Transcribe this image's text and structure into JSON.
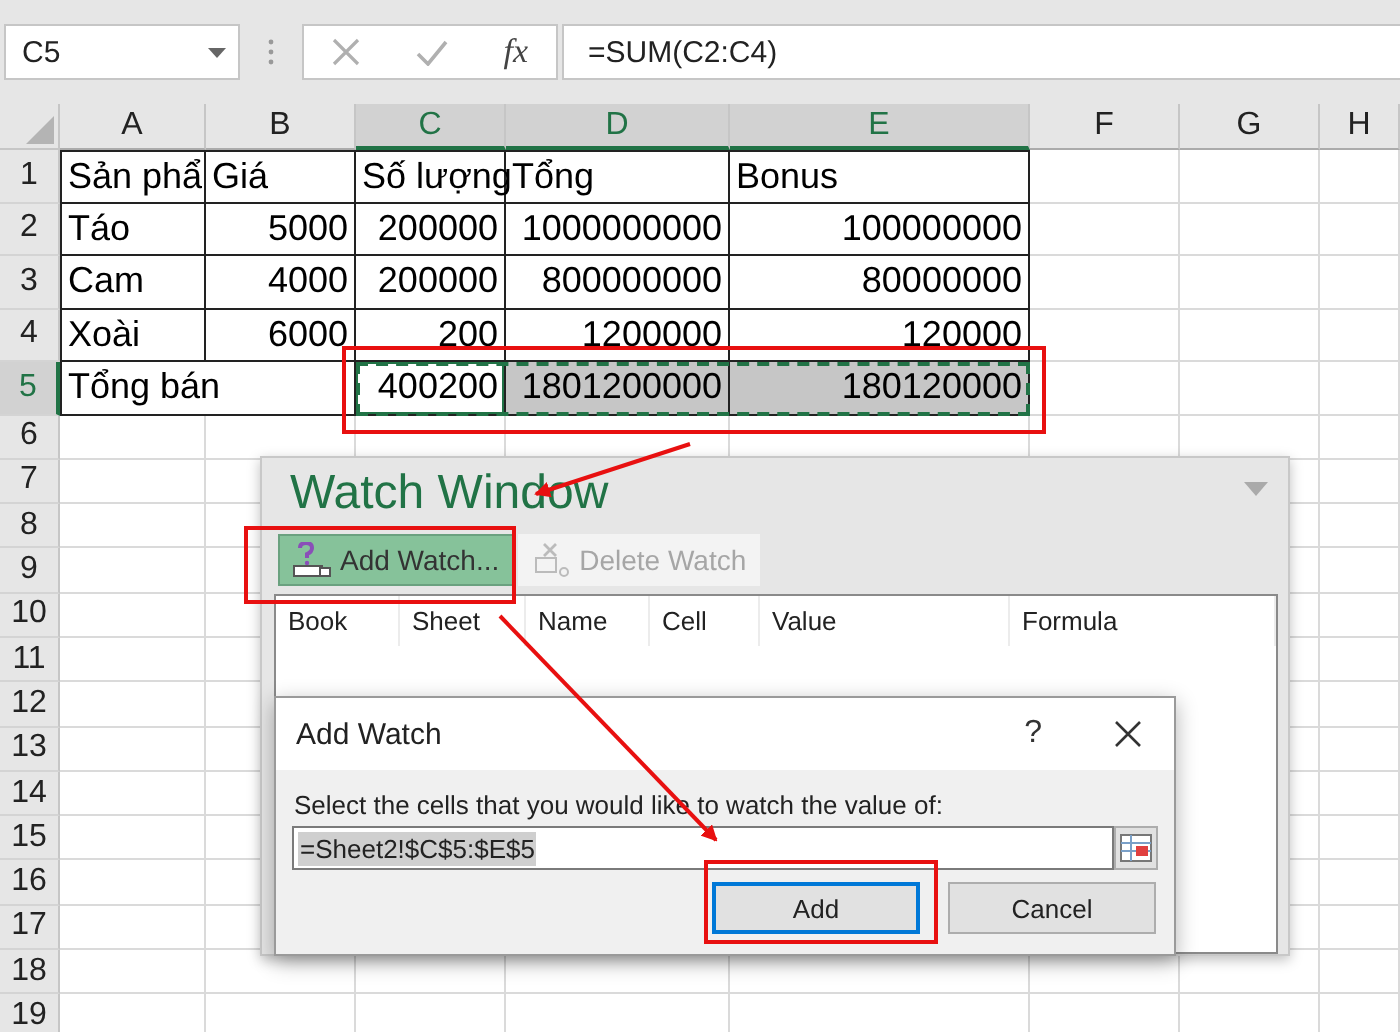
{
  "name_box": {
    "value": "C5"
  },
  "formula_bar": {
    "function_label": "fx",
    "formula": "=SUM(C2:C4)"
  },
  "columns": [
    {
      "label": "A",
      "selected": false
    },
    {
      "label": "B",
      "selected": false
    },
    {
      "label": "C",
      "selected": true
    },
    {
      "label": "D",
      "selected": true
    },
    {
      "label": "E",
      "selected": true
    },
    {
      "label": "F",
      "selected": false
    },
    {
      "label": "G",
      "selected": false
    },
    {
      "label": "H",
      "selected": false
    }
  ],
  "rows": [
    {
      "number": "1",
      "selected": false,
      "cells": [
        {
          "text": "Sản phẩ",
          "kind": "text",
          "selected": false,
          "active": false
        },
        {
          "text": "Giá",
          "kind": "text",
          "selected": false,
          "active": false
        },
        {
          "text": "Số lượng",
          "kind": "text",
          "selected": false,
          "active": false
        },
        {
          "text": "Tổng",
          "kind": "text",
          "selected": false,
          "active": false
        },
        {
          "text": "Bonus",
          "kind": "text",
          "selected": false,
          "active": false
        }
      ]
    },
    {
      "number": "2",
      "selected": false,
      "cells": [
        {
          "text": "Táo",
          "kind": "text",
          "selected": false,
          "active": false
        },
        {
          "text": "5000",
          "kind": "number",
          "selected": false,
          "active": false
        },
        {
          "text": "200000",
          "kind": "number",
          "selected": false,
          "active": false
        },
        {
          "text": "1000000000",
          "kind": "number",
          "selected": false,
          "active": false
        },
        {
          "text": "100000000",
          "kind": "number",
          "selected": false,
          "active": false
        }
      ]
    },
    {
      "number": "3",
      "selected": false,
      "cells": [
        {
          "text": "Cam",
          "kind": "text",
          "selected": false,
          "active": false
        },
        {
          "text": "4000",
          "kind": "number",
          "selected": false,
          "active": false
        },
        {
          "text": "200000",
          "kind": "number",
          "selected": false,
          "active": false
        },
        {
          "text": "800000000",
          "kind": "number",
          "selected": false,
          "active": false
        },
        {
          "text": "80000000",
          "kind": "number",
          "selected": false,
          "active": false
        }
      ]
    },
    {
      "number": "4",
      "selected": false,
      "cells": [
        {
          "text": "Xoài",
          "kind": "text",
          "selected": false,
          "active": false
        },
        {
          "text": "6000",
          "kind": "number",
          "selected": false,
          "active": false
        },
        {
          "text": "200",
          "kind": "number",
          "selected": false,
          "active": false
        },
        {
          "text": "1200000",
          "kind": "number",
          "selected": false,
          "active": false
        },
        {
          "text": "120000",
          "kind": "number",
          "selected": false,
          "active": false
        }
      ]
    },
    {
      "number": "5",
      "selected": true,
      "cells": [
        {
          "text": "Tổng bán",
          "kind": "text",
          "merged": true,
          "selected": false,
          "active": false
        },
        {
          "text": "400200",
          "kind": "number",
          "selected": true,
          "active": true
        },
        {
          "text": "1801200000",
          "kind": "number",
          "selected": true,
          "active": false
        },
        {
          "text": "180120000",
          "kind": "number",
          "selected": true,
          "active": false
        }
      ]
    },
    {
      "number": "6",
      "selected": false
    },
    {
      "number": "7",
      "selected": false
    },
    {
      "number": "8",
      "selected": false
    },
    {
      "number": "9",
      "selected": false
    },
    {
      "number": "10",
      "selected": false
    },
    {
      "number": "11",
      "selected": false
    },
    {
      "number": "12",
      "selected": false
    },
    {
      "number": "13",
      "selected": false
    },
    {
      "number": "14",
      "selected": false
    },
    {
      "number": "15",
      "selected": false
    },
    {
      "number": "16",
      "selected": false
    },
    {
      "number": "17",
      "selected": false
    },
    {
      "number": "18",
      "selected": false
    },
    {
      "number": "19",
      "selected": false
    }
  ],
  "watch_window": {
    "title": "Watch Window",
    "buttons": [
      {
        "label": "Add Watch...",
        "kind": "add",
        "selected": true,
        "disabled": false
      },
      {
        "label": "Delete Watch",
        "kind": "delete",
        "selected": false,
        "disabled": true
      }
    ],
    "columns": [
      "Book",
      "Sheet",
      "Name",
      "Cell",
      "Value",
      "Formula"
    ]
  },
  "add_watch_dialog": {
    "title": "Add Watch",
    "help": "?",
    "prompt": "Select the cells that you would like to watch the value of:",
    "range_value": "=Sheet2!$C$5:$E$5",
    "buttons": [
      {
        "label": "Add",
        "default": true
      },
      {
        "label": "Cancel",
        "default": false
      }
    ]
  }
}
